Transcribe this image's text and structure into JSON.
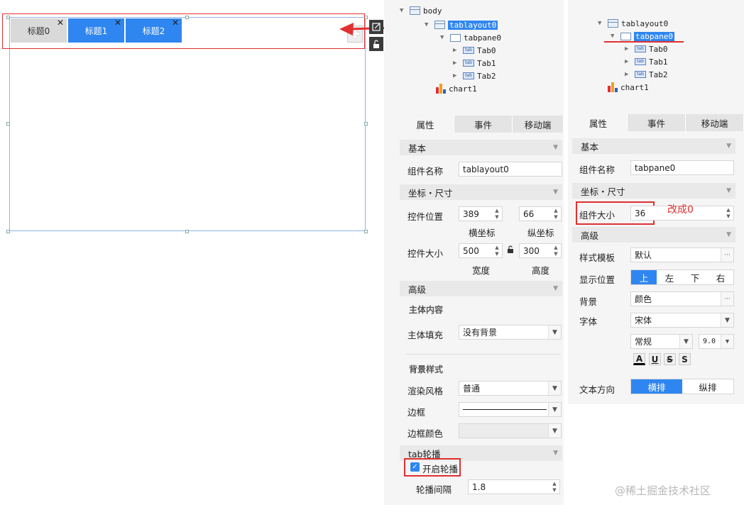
{
  "canvas": {
    "tabs": [
      {
        "label": "标题0",
        "style": "grey"
      },
      {
        "label": "标题1",
        "style": "blue"
      },
      {
        "label": "标题2",
        "style": "blue"
      }
    ],
    "close_glyph": "✕",
    "add_glyph": "✚"
  },
  "tree_left": {
    "items": [
      {
        "label": "body",
        "icon": "layout-icon"
      },
      {
        "label": "tablayout0",
        "icon": "layout-icon",
        "selected": true
      },
      {
        "label": "tabpane0",
        "icon": "pane-icon"
      },
      {
        "label": "Tab0",
        "icon": "tab-icon"
      },
      {
        "label": "Tab1",
        "icon": "tab-icon"
      },
      {
        "label": "Tab2",
        "icon": "tab-icon"
      },
      {
        "label": "chart1",
        "icon": "chart-icon"
      }
    ],
    "tab_icon_text": "tab"
  },
  "tree_right": {
    "items": [
      {
        "label": "tablayout0",
        "icon": "layout-icon"
      },
      {
        "label": "tabpane0",
        "icon": "pane-icon",
        "selected": true
      },
      {
        "label": "Tab0",
        "icon": "tab-icon"
      },
      {
        "label": "Tab1",
        "icon": "tab-icon"
      },
      {
        "label": "Tab2",
        "icon": "tab-icon"
      },
      {
        "label": "chart1",
        "icon": "chart-icon"
      }
    ]
  },
  "left_panel": {
    "tabs": [
      "属性",
      "事件",
      "移动端"
    ],
    "section_basic": "基本",
    "name_label": "组件名称",
    "name_value": "tablayout0",
    "section_coord": "坐标・尺寸",
    "position_label": "控件位置",
    "pos_x": "389",
    "pos_y": "66",
    "pos_x_caption": "横坐标",
    "pos_y_caption": "纵坐标",
    "size_label": "控件大小",
    "width": "500",
    "height": "300",
    "width_caption": "宽度",
    "height_caption": "高度",
    "section_advanced": "高级",
    "body_content": "主体内容",
    "body_fill_label": "主体填充",
    "body_fill_value": "没有背景",
    "bg_style": "背景样式",
    "render_label": "渲染风格",
    "render_value": "普通",
    "border_label": "边框",
    "border_color_label": "边框颜色",
    "carousel_section": "tab轮播",
    "carousel_enable": "开启轮播",
    "carousel_interval_label": "轮播间隔",
    "carousel_interval": "1.8"
  },
  "right_panel": {
    "tabs": [
      "属性",
      "事件",
      "移动端"
    ],
    "section_basic": "基本",
    "name_label": "组件名称",
    "name_value": "tabpane0",
    "section_coord": "坐标・尺寸",
    "size_label": "组件大小",
    "size_value": "36",
    "annotation": "改成0",
    "section_advanced": "高级",
    "template_label": "样式模板",
    "template_value": "默认",
    "display_label": "显示位置",
    "display_options": [
      "上",
      "左",
      "下",
      "右"
    ],
    "bg_label": "背景",
    "bg_value": "颜色",
    "font_label": "字体",
    "font_value": "宋体",
    "font_style": "常规",
    "font_size": "9.0",
    "format_buttons": [
      "A",
      "U",
      "S",
      "S"
    ],
    "text_dir_label": "文本方向",
    "text_dir_options": [
      "横排",
      "纵排"
    ]
  },
  "watermark": "@稀土掘金技术社区",
  "colors": {
    "accent": "#2f86f0",
    "annotation": "#e03030"
  }
}
